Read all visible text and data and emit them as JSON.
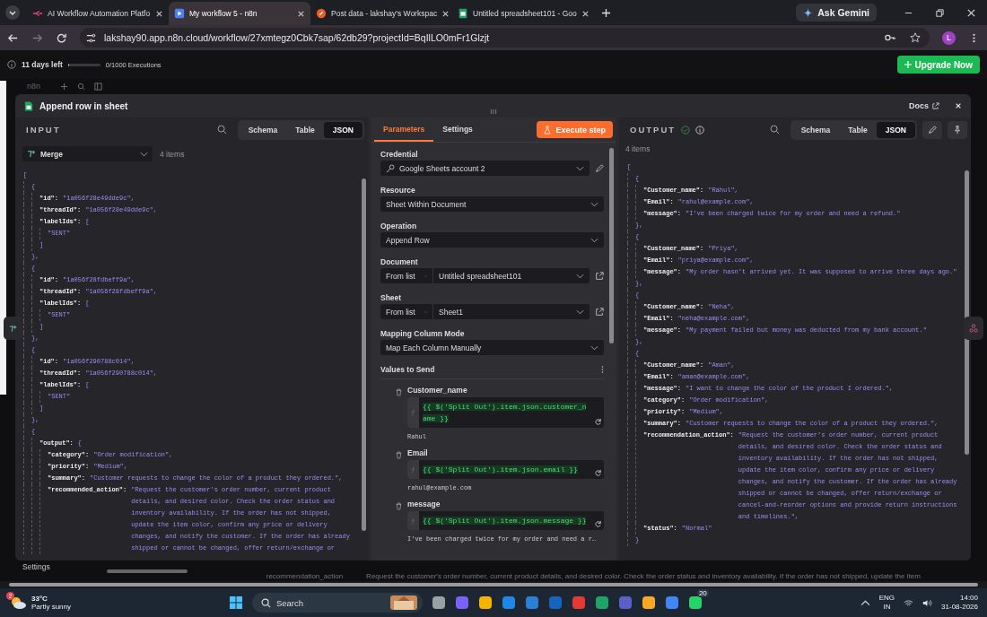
{
  "browser": {
    "tabs": [
      {
        "title": "AI Workflow Automation Platfo",
        "selected": false
      },
      {
        "title": "My workflow 5 - n8n",
        "selected": true
      },
      {
        "title": "Post data - lakshay's Workspac",
        "selected": false
      },
      {
        "title": "Untitled spreadsheet101 - Goo",
        "selected": false
      }
    ],
    "gemini": "Ask Gemini",
    "url": "lakshay90.app.n8n.cloud/workflow/27xmtegz0Cbk7sap/62db29?projectId=BqIlLO0mFr1Glzjt",
    "profile": "L"
  },
  "trial": {
    "days_left": "11 days left",
    "level": 0.02,
    "executions": "0/1000 Executions",
    "upgrade": "Upgrade Now"
  },
  "background": {
    "brand": "n8n",
    "settings": "Settings",
    "column": "recommendation_action",
    "cell": "Request the customer's order number, current product details, and desired color. Check the order status and inventory availability. If the order has not shipped, update the item"
  },
  "modal": {
    "title": "Append row in sheet",
    "docs": "Docs"
  },
  "input": {
    "title": "INPUT",
    "views": [
      {
        "label": "Schema",
        "selected": false
      },
      {
        "label": "Table",
        "selected": false
      },
      {
        "label": "JSON",
        "selected": true
      }
    ],
    "source": "Merge",
    "count": "4 items",
    "json": [
      {
        "open": "[",
        "children": [
          {
            "open": "{",
            "close": "},",
            "children": [
              {
                "key": "\"id\":",
                "value": "\"1a056f28e49dde9c\","
              },
              {
                "key": "\"threadId\":",
                "value": "\"1a056f28e49dde9c\","
              },
              {
                "key": "\"labelIds\":",
                "open": "[",
                "close": "]",
                "children": [
                  {
                    "value": "\"SENT\""
                  }
                ]
              }
            ]
          },
          {
            "open": "{",
            "close": "},",
            "children": [
              {
                "key": "\"id\":",
                "value": "\"1a056f28fdbeff9a\","
              },
              {
                "key": "\"threadId\":",
                "value": "\"1a056f28fdbeff9a\","
              },
              {
                "key": "\"labelIds\":",
                "open": "[",
                "close": "]",
                "children": [
                  {
                    "value": "\"SENT\""
                  }
                ]
              }
            ]
          },
          {
            "open": "{",
            "close": "},",
            "children": [
              {
                "key": "\"id\":",
                "value": "\"1a056f290788c014\","
              },
              {
                "key": "\"threadId\":",
                "value": "\"1a056f290788c014\","
              },
              {
                "key": "\"labelIds\":",
                "open": "[",
                "close": "]",
                "children": [
                  {
                    "value": "\"SENT\""
                  }
                ]
              }
            ]
          },
          {
            "open": "{",
            "children": [
              {
                "key": "\"output\":",
                "open": "{",
                "children": [
                  {
                    "key": "\"category\":",
                    "value": "\"Order modification\","
                  },
                  {
                    "key": "\"priority\":",
                    "value": "\"Medium\","
                  },
                  {
                    "key": "\"summary\":",
                    "value": "\"Customer requests to change the color of a product they ordered.\","
                  },
                  {
                    "key": "\"recommended_action\":",
                    "value": "\"Request the customer's order number, current product details, and desired color. Check the order status and inventory availability. If the order has not shipped, update the item color, confirm any price or delivery changes, and notify the customer. If the order has already shipped or cannot be changed, offer return/exchange or"
                  }
                ]
              }
            ]
          }
        ]
      }
    ]
  },
  "parameters": {
    "tabs": [
      {
        "label": "Parameters",
        "selected": true
      },
      {
        "label": "Settings",
        "selected": false
      }
    ],
    "execute": "Execute step",
    "fields": [
      {
        "kind": "credential",
        "label": "Credential",
        "value": "Google Sheets account 2"
      },
      {
        "kind": "select",
        "label": "Resource",
        "value": "Sheet Within Document"
      },
      {
        "kind": "select",
        "label": "Operation",
        "value": "Append Row"
      },
      {
        "kind": "locator",
        "label": "Document",
        "mode": "From list",
        "value": "Untitled spreadsheet101"
      },
      {
        "kind": "locator",
        "label": "Sheet",
        "mode": "From list",
        "value": "Sheet1"
      },
      {
        "kind": "select",
        "label": "Mapping Column Mode",
        "value": "Map Each Column Manually"
      }
    ],
    "values_title": "Values to Send",
    "values": [
      {
        "name": "Customer_name",
        "expression": "{{ $('Split Out').item.json.customer_name }}",
        "preview": "Rahul"
      },
      {
        "name": "Email",
        "expression": "{{ $('Split Out').item.json.email }}",
        "preview": "rahul@example.com"
      },
      {
        "name": "message",
        "expression": "{{ $('Split Out').item.json.message }}",
        "preview": "I've been charged twice for my order and need a r…"
      }
    ]
  },
  "output": {
    "title": "OUTPUT",
    "views": [
      {
        "label": "Schema",
        "selected": false
      },
      {
        "label": "Table",
        "selected": false
      },
      {
        "label": "JSON",
        "selected": true
      }
    ],
    "count": "4 items",
    "json": [
      {
        "open": "[",
        "children": [
          {
            "open": "{",
            "close": "},",
            "children": [
              {
                "key": "\"Customer_name\":",
                "value": "\"Rahul\","
              },
              {
                "key": "\"Email\":",
                "value": "\"rahul@example.com\","
              },
              {
                "key": "\"message\":",
                "value": "\"I've been charged twice for my order and need a refund.\""
              }
            ]
          },
          {
            "open": "{",
            "close": "},",
            "children": [
              {
                "key": "\"Customer_name\":",
                "value": "\"Priya\","
              },
              {
                "key": "\"Email\":",
                "value": "\"priya@example.com\","
              },
              {
                "key": "\"message\":",
                "value": "\"My order hasn't arrived yet. It was supposed to arrive three days ago.\""
              }
            ]
          },
          {
            "open": "{",
            "close": "},",
            "children": [
              {
                "key": "\"Customer_name\":",
                "value": "\"Neha\","
              },
              {
                "key": "\"Email\":",
                "value": "\"neha@example.com\","
              },
              {
                "key": "\"message\":",
                "value": "\"My payment failed but money was deducted from my bank account.\""
              }
            ]
          },
          {
            "open": "{",
            "close": "}",
            "children": [
              {
                "key": "\"Customer_name\":",
                "value": "\"Aman\","
              },
              {
                "key": "\"Email\":",
                "value": "\"aman@example.com\","
              },
              {
                "key": "\"message\":",
                "value": "\"I want to change the color of the product I ordered.\","
              },
              {
                "key": "\"category\":",
                "value": "\"Order modification\","
              },
              {
                "key": "\"priority\":",
                "value": "\"Medium\","
              },
              {
                "key": "\"summary\":",
                "value": "\"Customer requests to change the color of a product they ordered.\","
              },
              {
                "key": "\"recommendation_action\":",
                "value": "\"Request the customer's order number, current product details, and desired color. Check the order status and inventory availability. If the order has not shipped, update the item color, confirm any price or delivery changes, and notify the customer. If the order has already shipped or cannot be changed, offer return/exchange or cancel-and-reorder options and provide return instructions and timelines.\","
              },
              {
                "key": "\"status\":",
                "value": "\"Normal\""
              }
            ]
          }
        ]
      }
    ]
  },
  "taskbar": {
    "temperature": "33°C",
    "weather": "Partly sunny",
    "weather_badge": "2",
    "search": "Search",
    "app_badge": "20",
    "language": "ENG",
    "region": "IN",
    "time": "14:00",
    "date": "31-08-2026"
  }
}
